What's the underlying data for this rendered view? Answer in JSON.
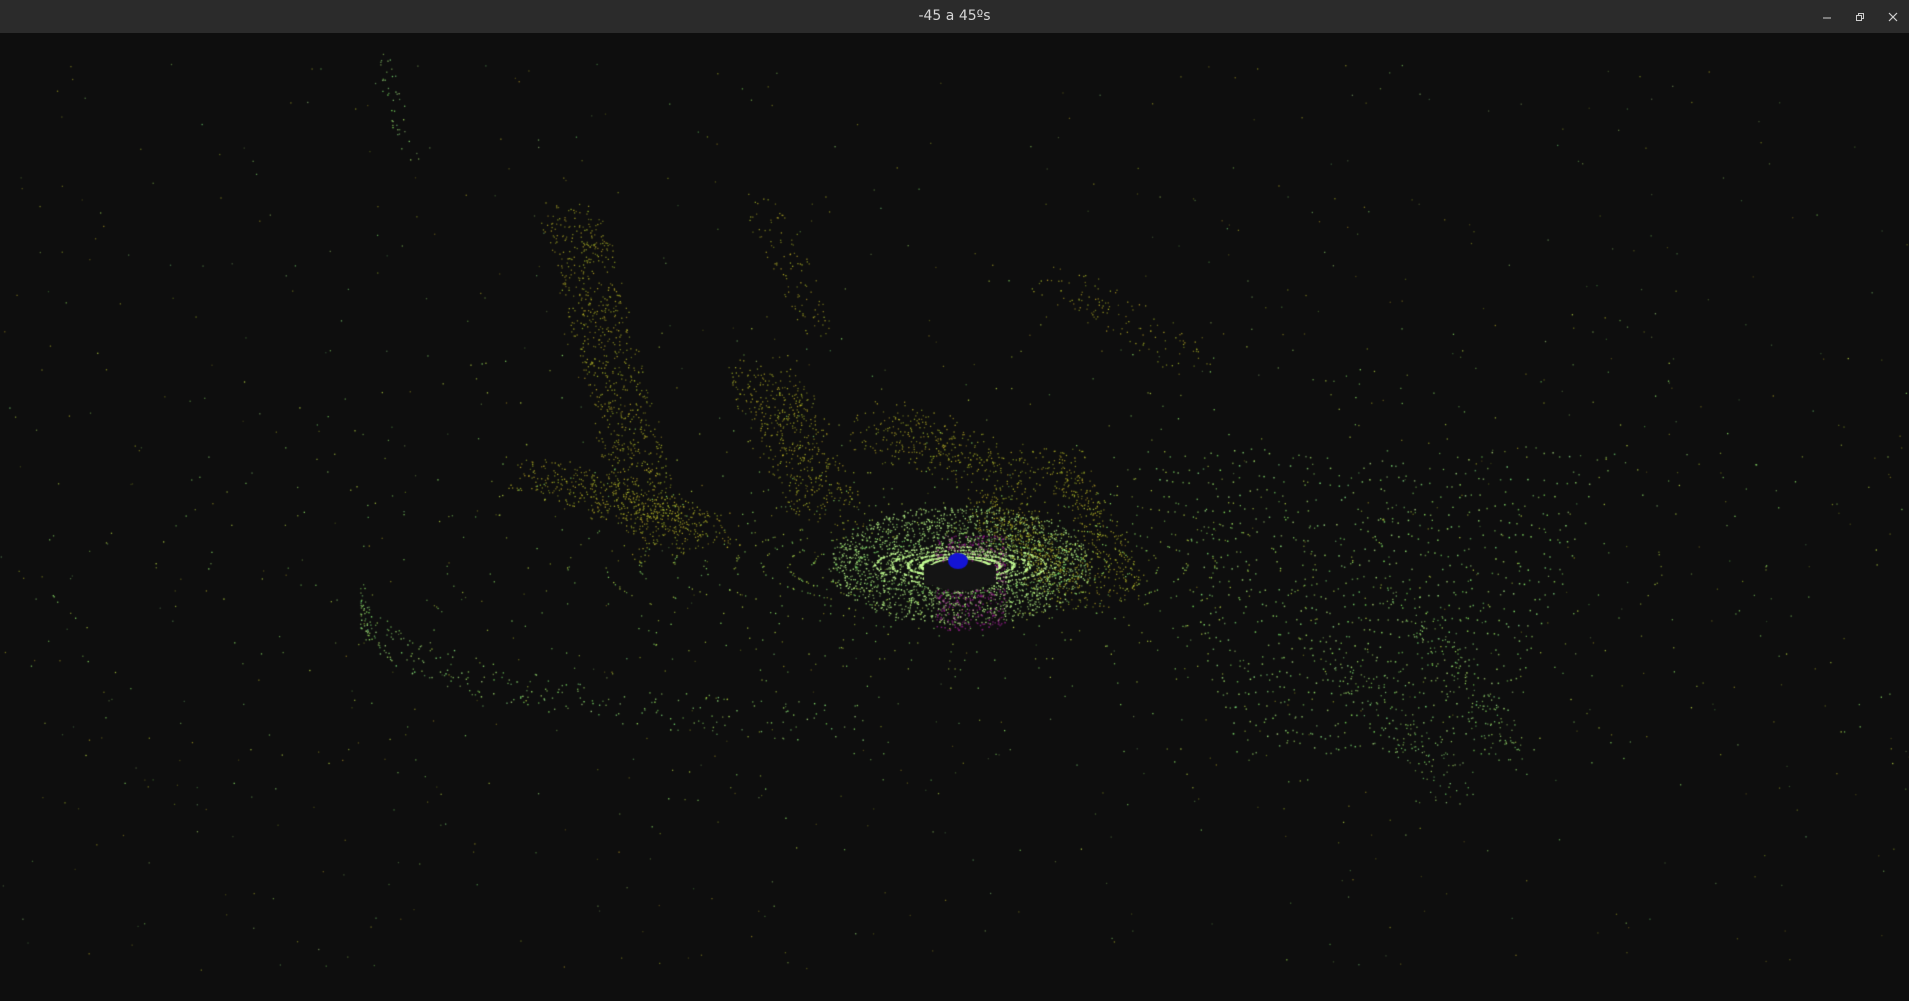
{
  "window": {
    "title": "-45 a 45ºs"
  },
  "controls": {
    "minimize_icon": "minimize-icon",
    "maximize_icon": "restore-icon",
    "close_icon": "close-icon"
  },
  "colors": {
    "titlebar": "#2b2b2b",
    "background": "#0e0e0e",
    "point_yellow": "#b8c43a",
    "point_green": "#8fe07a",
    "point_bright": "#c8ff9a",
    "sensor_blue": "#1010d0",
    "magenta": "#9a1a8a"
  }
}
